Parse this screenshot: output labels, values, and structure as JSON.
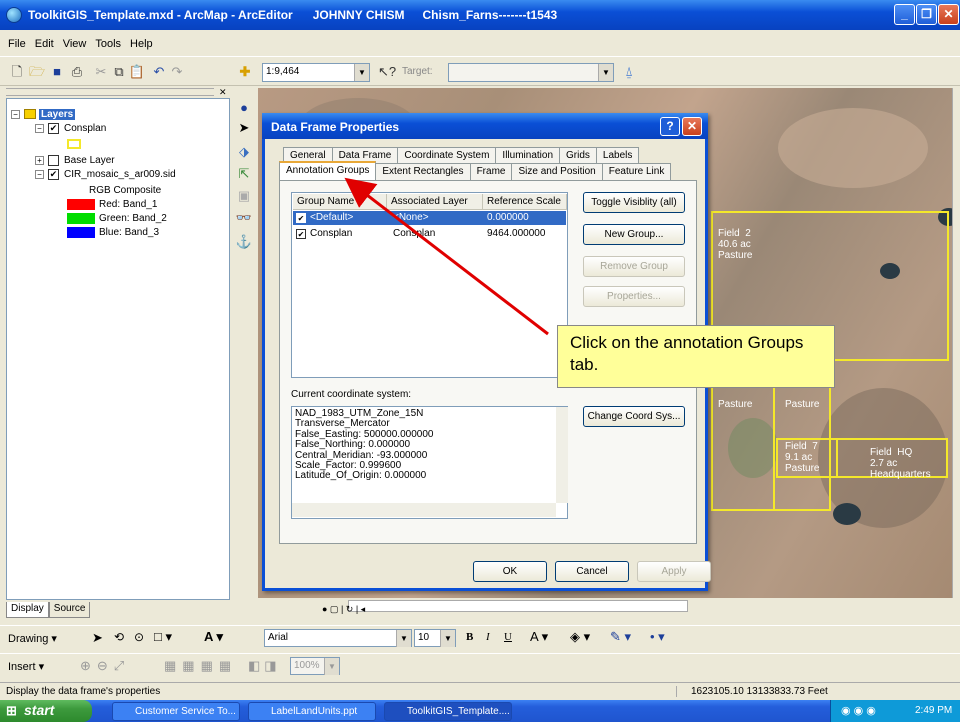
{
  "window": {
    "title": "ToolkitGIS_Template.mxd - ArcMap - ArcEditor",
    "user": "JOHNNY CHISM",
    "project": "Chism_Farns-------t1543"
  },
  "menu": [
    "File",
    "Edit",
    "View",
    "Tools",
    "Help"
  ],
  "toolbar": {
    "scale": "1:9,464",
    "target_label": "Target:"
  },
  "toc": {
    "root": "Layers",
    "items": [
      {
        "label": "Consplan",
        "checked": true
      },
      {
        "label": "Base Layer",
        "checked": false
      },
      {
        "label": "CIR_mosaic_s_ar009.sid",
        "checked": true
      }
    ],
    "rgb_label": "RGB Composite",
    "bands": [
      {
        "label": "Red:   Band_1",
        "color": "#ff0000"
      },
      {
        "label": "Green: Band_2",
        "color": "#00dd00"
      },
      {
        "label": "Blue:   Band_3",
        "color": "#0000ff"
      }
    ],
    "tabs": [
      "Display",
      "Source"
    ]
  },
  "map": {
    "fields": [
      {
        "label": "Field  2\n40.6 ac\nPasture"
      },
      {
        "label": "Pasture"
      },
      {
        "label": "Pasture"
      },
      {
        "label": "Field  7\n9.1 ac\nPasture"
      },
      {
        "label": "Field  HQ\n2.7 ac\nHeadquarters"
      }
    ]
  },
  "dialog": {
    "title": "Data Frame Properties",
    "tabs_row1": [
      "General",
      "Data Frame",
      "Coordinate System",
      "Illumination",
      "Grids",
      "Labels"
    ],
    "tabs_row2": [
      "Annotation Groups",
      "Extent Rectangles",
      "Frame",
      "Size and Position",
      "Feature Link"
    ],
    "columns": [
      "Group Name",
      "Associated Layer",
      "Reference Scale"
    ],
    "rows": [
      {
        "name": "<Default>",
        "layer": "<None>",
        "scale": "0.000000",
        "checked": true
      },
      {
        "name": "Consplan",
        "layer": "Consplan",
        "scale": "9464.000000",
        "checked": true
      }
    ],
    "buttons": {
      "toggle": "Toggle Visiblity (all)",
      "new_group": "New Group...",
      "remove_group": "Remove Group",
      "properties": "Properties...",
      "change_coord": "Change Coord Sys...",
      "ok": "OK",
      "cancel": "Cancel",
      "apply": "Apply"
    },
    "coord_label": "Current coordinate system:",
    "coord_text": "NAD_1983_UTM_Zone_15N\nTransverse_Mercator\nFalse_Easting: 500000.000000\nFalse_Northing: 0.000000\nCentral_Meridian: -93.000000\nScale_Factor: 0.999600\nLatitude_Of_Origin: 0.000000"
  },
  "callout": "Click on the annotation Groups tab.",
  "drawing_toolbar": {
    "drawing": "Drawing",
    "font": "Arial",
    "size": "10",
    "insert": "Insert",
    "zoom": "100%"
  },
  "status": {
    "message": "Display the data frame's properties",
    "coords": "1623105.10  13133833.73 Feet"
  },
  "taskbar": {
    "start": "start",
    "items": [
      "Customer Service To...",
      "LabelLandUnits.ppt",
      "ToolkitGIS_Template...."
    ],
    "time": "2:49 PM"
  }
}
